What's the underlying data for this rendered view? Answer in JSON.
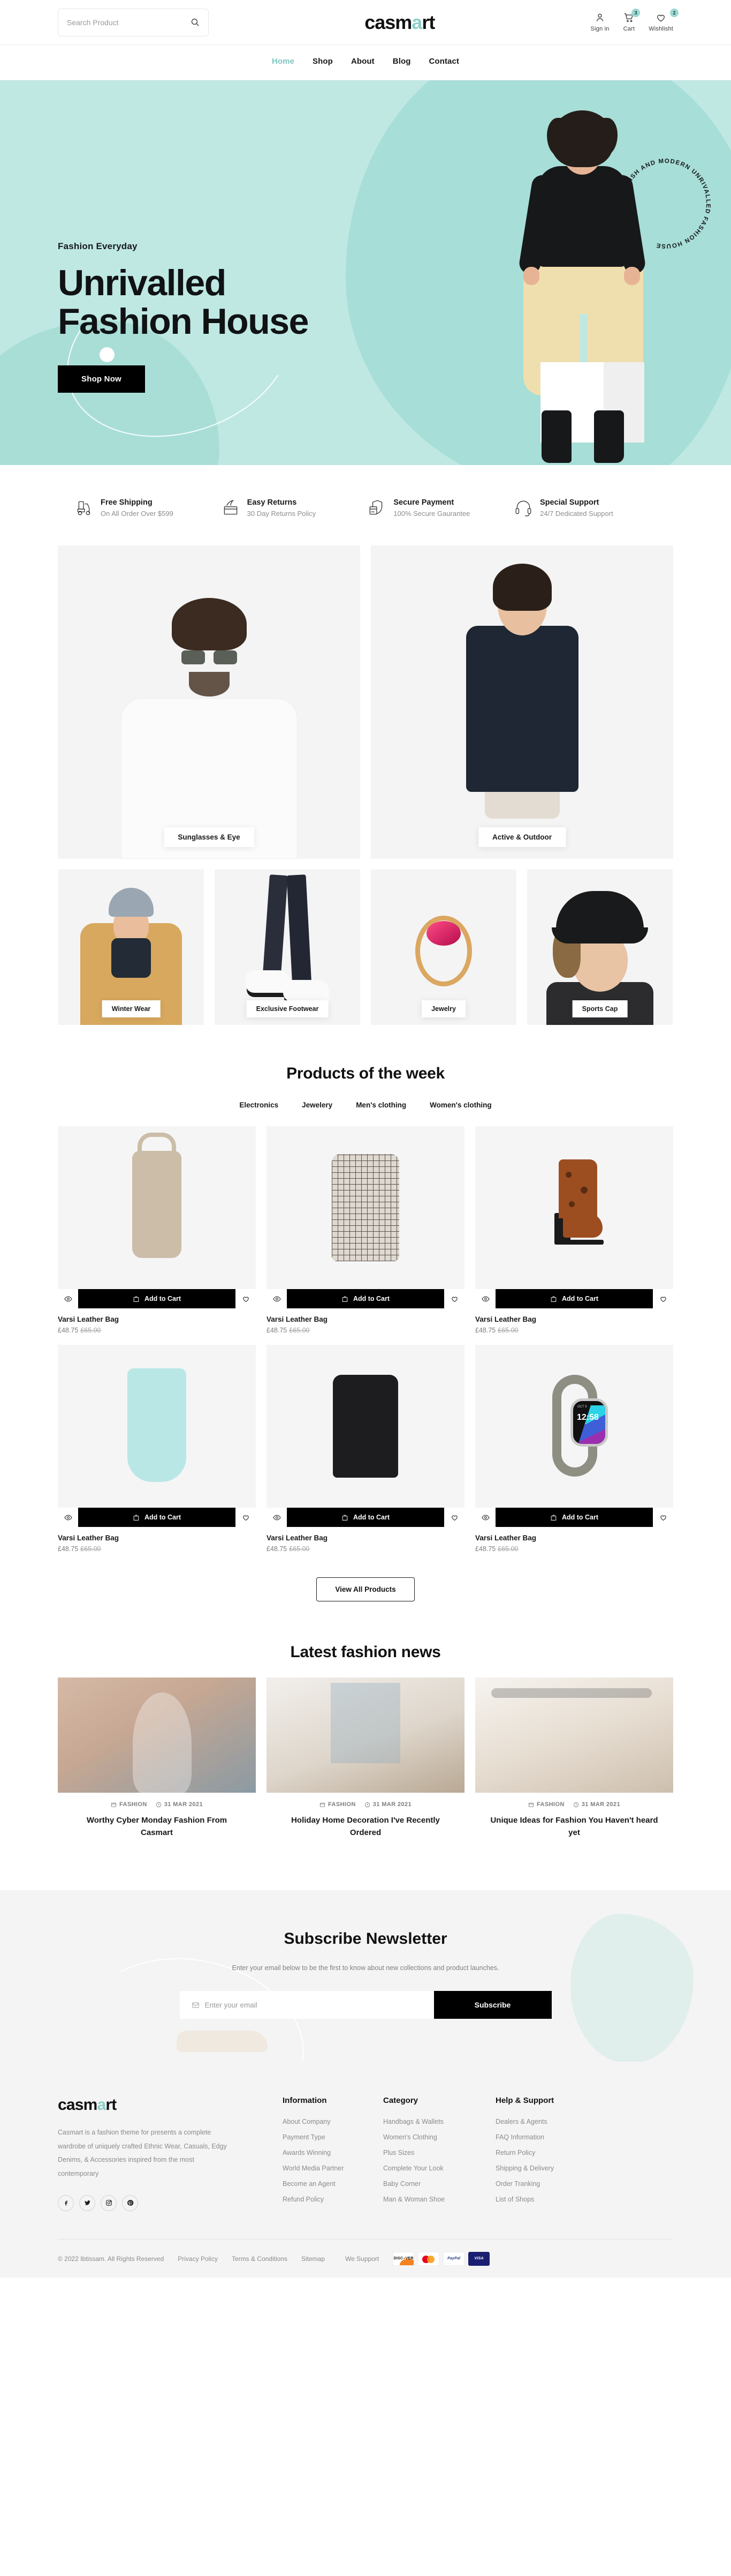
{
  "header": {
    "search": {
      "placeholder": "Search Product",
      "value": ""
    },
    "logo": {
      "part1": "casm",
      "accent": "a",
      "part2": "rt"
    },
    "actions": [
      {
        "label": "Sign in",
        "icon": "user-icon",
        "badge": ""
      },
      {
        "label": "Cart",
        "icon": "cart-icon",
        "badge": "3"
      },
      {
        "label": "Wishlisht",
        "icon": "heart-icon",
        "badge": "2"
      }
    ],
    "nav": [
      {
        "label": "Home",
        "active": true
      },
      {
        "label": "Shop",
        "active": false
      },
      {
        "label": "About",
        "active": false
      },
      {
        "label": "Blog",
        "active": false
      },
      {
        "label": "Contact",
        "active": false
      }
    ]
  },
  "hero": {
    "eyebrow": "Fashion Everyday",
    "title_line1": "Unrivalled",
    "title_line2": "Fashion House",
    "cta": "Shop Now",
    "ring_text": "STYLISH AND MODERN UNRIVALLED FASHION HOUSE",
    "bg_color": "#bfe8e3"
  },
  "features": [
    {
      "icon": "scooter-icon",
      "title": "Free Shipping",
      "sub": "On All Order Over $599"
    },
    {
      "icon": "return-box-icon",
      "title": "Easy Returns",
      "sub": "30 Day Returns Policy"
    },
    {
      "icon": "shield-payment-icon",
      "title": "Secure Payment",
      "sub": "100% Secure Gaurantee"
    },
    {
      "icon": "headset-icon",
      "title": "Special Support",
      "sub": "24/7 Dedicated Support"
    }
  ],
  "categories": {
    "big": [
      {
        "label": "Sunglasses & Eye"
      },
      {
        "label": "Active & Outdoor"
      }
    ],
    "small": [
      {
        "label": "Winter Wear"
      },
      {
        "label": "Exclusive Footwear"
      },
      {
        "label": "Jewelry"
      },
      {
        "label": "Sports Cap"
      }
    ]
  },
  "products_section": {
    "title": "Products of the week",
    "tabs": [
      {
        "label": "Electronics",
        "active": true
      },
      {
        "label": "Jewelery",
        "active": false
      },
      {
        "label": "Men's clothing",
        "active": false
      },
      {
        "label": "Women's clothing",
        "active": false
      }
    ],
    "add_to_cart_label": "Add to Cart",
    "view_all_label": "View All Products",
    "items": [
      {
        "name": "Varsi Leather Bag",
        "price": "£48.75",
        "old_price": "£65.00",
        "image": "beige-backpack"
      },
      {
        "name": "Varsi Leather Bag",
        "price": "£48.75",
        "old_price": "£65.00",
        "image": "plaid-shirt"
      },
      {
        "name": "Varsi Leather Bag",
        "price": "£48.75",
        "old_price": "£65.00",
        "image": "leopard-boot"
      },
      {
        "name": "Varsi Leather Bag",
        "price": "£48.75",
        "old_price": "£65.00",
        "image": "mint-blouse"
      },
      {
        "name": "Varsi Leather Bag",
        "price": "£48.75",
        "old_price": "£65.00",
        "image": "black-tee"
      },
      {
        "name": "Varsi Leather Bag",
        "price": "£48.75",
        "old_price": "£65.00",
        "image": "smart-watch"
      }
    ],
    "watch_display": {
      "time": "12:58",
      "date": "OCT 9"
    }
  },
  "blog_section": {
    "title": "Latest fashion news",
    "posts": [
      {
        "category": "FASHION",
        "date": "31 MAR 2021",
        "title": "Worthy Cyber Monday Fashion From Casmart"
      },
      {
        "category": "FASHION",
        "date": "31 MAR 2021",
        "title": "Holiday Home Decoration I've Recently Ordered"
      },
      {
        "category": "FASHION",
        "date": "31 MAR 2021",
        "title": "Unique Ideas for Fashion You Haven't heard yet"
      }
    ]
  },
  "newsletter": {
    "title": "Subscribe Newsletter",
    "subtitle": "Enter your email below to be the first to know about new collections and product launches.",
    "placeholder": "Enter your email",
    "value": "",
    "button": "Subscribe"
  },
  "footer": {
    "logo": {
      "part1": "casm",
      "accent": "a",
      "part2": "rt"
    },
    "description": "Casmart is a fashion theme for presents a complete wardrobe of uniquely crafted Ethnic Wear, Casuals, Edgy Denims, & Accessories inspired from the most contemporary",
    "socials": [
      {
        "name": "facebook-icon",
        "glyph": "f"
      },
      {
        "name": "twitter-icon",
        "glyph": "t"
      },
      {
        "name": "instagram-icon",
        "glyph": "◎"
      },
      {
        "name": "pinterest-icon",
        "glyph": "p"
      }
    ],
    "columns": [
      {
        "title": "Information",
        "links": [
          "About Company",
          "Payment Type",
          "Awards Winning",
          "World Media Partner",
          "Become an Agent",
          "Refund Policy"
        ]
      },
      {
        "title": "Category",
        "links": [
          "Handbags & Wallets",
          "Women's Clothing",
          "Plus Sizes",
          "Complete Your Look",
          "Baby Corner",
          "Man & Woman Shoe"
        ]
      },
      {
        "title": "Help & Support",
        "links": [
          "Dealers & Agents",
          "FAQ Information",
          "Return Policy",
          "Shipping & Delivery",
          "Order Tranking",
          "List of Shops"
        ]
      }
    ],
    "bottom": {
      "copyright": "© 2022 Ibtissam. All Rights Reserved",
      "links": [
        "Privacy Policy",
        "Terms & Conditions",
        "Sitemap"
      ],
      "support_label": "We Support",
      "cards": [
        "DISCOVER",
        "MASTERCARD",
        "PayPal",
        "VISA"
      ]
    }
  }
}
